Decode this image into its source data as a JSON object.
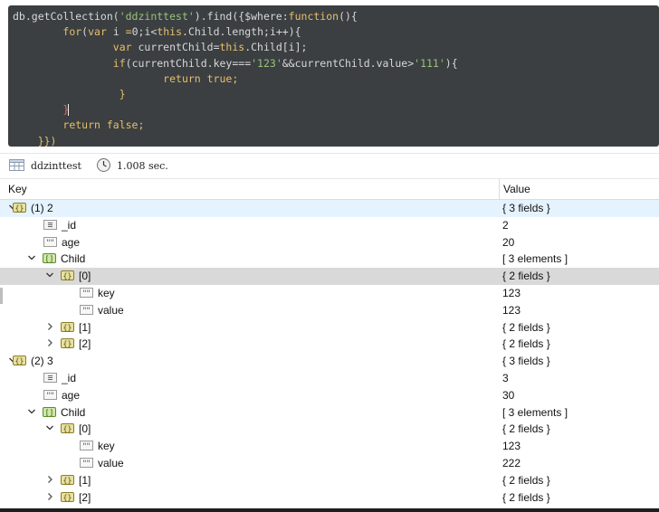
{
  "editor": {
    "lines": [
      [
        {
          "t": "db.getCollection(",
          "c": "p"
        },
        {
          "t": "'ddzinttest'",
          "c": "s"
        },
        {
          "t": ").find({",
          "c": "p"
        },
        {
          "t": "$where",
          "c": "p"
        },
        {
          "t": ":",
          "c": "p"
        },
        {
          "t": "function",
          "c": "k"
        },
        {
          "t": "(){",
          "c": "p"
        }
      ],
      [
        {
          "t": "        ",
          "c": "p"
        },
        {
          "t": "for",
          "c": "k"
        },
        {
          "t": "(",
          "c": "p"
        },
        {
          "t": "var",
          "c": "k"
        },
        {
          "t": " i ",
          "c": "p"
        },
        {
          "t": "=",
          "c": "k"
        },
        {
          "t": "0;i<",
          "c": "p"
        },
        {
          "t": "this",
          "c": "k"
        },
        {
          "t": ".Child.length;i++){",
          "c": "p"
        }
      ],
      [
        {
          "t": "                ",
          "c": "p"
        },
        {
          "t": "var",
          "c": "k"
        },
        {
          "t": " currentChild=",
          "c": "p"
        },
        {
          "t": "this",
          "c": "k"
        },
        {
          "t": ".Child[i];",
          "c": "p"
        }
      ],
      [
        {
          "t": "                ",
          "c": "p"
        },
        {
          "t": "if",
          "c": "k"
        },
        {
          "t": "(currentChild.key===",
          "c": "p"
        },
        {
          "t": "'123'",
          "c": "s"
        },
        {
          "t": "&&currentChild.value>",
          "c": "p"
        },
        {
          "t": "'111'",
          "c": "s"
        },
        {
          "t": "){",
          "c": "p"
        }
      ],
      [
        {
          "t": "                        ",
          "c": "p"
        },
        {
          "t": "return true;",
          "c": "k"
        }
      ],
      [
        {
          "t": "                 }",
          "c": "k"
        }
      ],
      [
        {
          "t": "        ",
          "c": "p"
        },
        {
          "t": "}",
          "c": "x"
        },
        {
          "t": "|",
          "c": "cursor"
        }
      ],
      [
        {
          "t": "        ",
          "c": "p"
        },
        {
          "t": "return false;",
          "c": "k"
        }
      ],
      [
        {
          "t": "    ",
          "c": "p"
        },
        {
          "t": "}})",
          "c": "k"
        }
      ]
    ]
  },
  "status": {
    "collection": "ddzinttest",
    "time": "1.008 sec."
  },
  "table": {
    "key_header": "Key",
    "value_header": "Value",
    "rows": [
      {
        "indent": 0,
        "chev": "down",
        "icon": "object",
        "key": "(1) 2",
        "value": "{ 3 fields }",
        "hl": "blue"
      },
      {
        "indent": 1,
        "chev": "",
        "icon": "number",
        "key": "_id",
        "value": "2"
      },
      {
        "indent": 1,
        "chev": "",
        "icon": "string",
        "key": "age",
        "value": "20"
      },
      {
        "indent": 1,
        "chev": "down",
        "icon": "array",
        "key": "Child",
        "value": "[ 3 elements ]"
      },
      {
        "indent": 2,
        "chev": "down",
        "icon": "object",
        "key": "[0]",
        "value": "{ 2 fields }",
        "hl": "gray"
      },
      {
        "indent": 3,
        "chev": "",
        "icon": "string",
        "key": "key",
        "value": "123"
      },
      {
        "indent": 3,
        "chev": "",
        "icon": "string",
        "key": "value",
        "value": "123"
      },
      {
        "indent": 2,
        "chev": "right",
        "icon": "object",
        "key": "[1]",
        "value": "{ 2 fields }"
      },
      {
        "indent": 2,
        "chev": "right",
        "icon": "object",
        "key": "[2]",
        "value": "{ 2 fields }"
      },
      {
        "indent": 0,
        "chev": "down",
        "icon": "object",
        "key": "(2) 3",
        "value": "{ 3 fields }"
      },
      {
        "indent": 1,
        "chev": "",
        "icon": "number",
        "key": "_id",
        "value": "3"
      },
      {
        "indent": 1,
        "chev": "",
        "icon": "string",
        "key": "age",
        "value": "30"
      },
      {
        "indent": 1,
        "chev": "down",
        "icon": "array",
        "key": "Child",
        "value": "[ 3 elements ]"
      },
      {
        "indent": 2,
        "chev": "down",
        "icon": "object",
        "key": "[0]",
        "value": "{ 2 fields }"
      },
      {
        "indent": 3,
        "chev": "",
        "icon": "string",
        "key": "key",
        "value": "123"
      },
      {
        "indent": 3,
        "chev": "",
        "icon": "string",
        "key": "value",
        "value": "222"
      },
      {
        "indent": 2,
        "chev": "right",
        "icon": "object",
        "key": "[1]",
        "value": "{ 2 fields }"
      },
      {
        "indent": 2,
        "chev": "right",
        "icon": "object",
        "key": "[2]",
        "value": "{ 2 fields }"
      }
    ]
  }
}
